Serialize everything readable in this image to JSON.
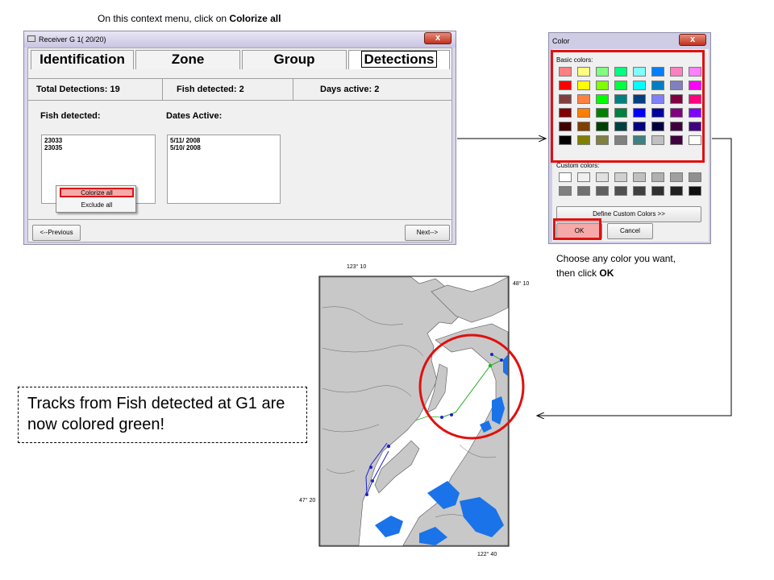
{
  "top_caption": {
    "prefix": "On this context menu, click on ",
    "bold": "Colorize all"
  },
  "receiver_window": {
    "title": "Receiver G 1( 20/20)",
    "close_label": "x",
    "tabs": [
      "Identification",
      "Zone",
      "Group",
      "Detections"
    ],
    "active_tab": "Detections",
    "stats": {
      "total_detections": "Total Detections:  19",
      "fish_detected": "Fish detected:  2",
      "days_active": "Days active:  2"
    },
    "fish_detected_label": "Fish detected:",
    "fish_list": [
      "23033",
      "23035"
    ],
    "dates_active_label": "Dates Active:",
    "dates_list": [
      "5/11/ 2008",
      "5/10/ 2008"
    ],
    "context_menu": [
      "Colorize all",
      "Exclude all"
    ],
    "previous_button": "<--Previous",
    "next_button": "Next-->"
  },
  "color_dialog": {
    "title": "Color",
    "close_label": "x",
    "basic_colors_label": "Basic colors:",
    "custom_colors_label": "Custom colors:",
    "define_custom_button": "Define Custom Colors >>",
    "ok_button": "OK",
    "cancel_button": "Cancel",
    "basic_colors": [
      "#ff8080",
      "#ffff80",
      "#80ff80",
      "#00ff80",
      "#80ffff",
      "#0080ff",
      "#ff80c0",
      "#ff80ff",
      "#ff0000",
      "#ffff00",
      "#80ff00",
      "#00ff40",
      "#00ffff",
      "#0080c0",
      "#8080c0",
      "#ff00ff",
      "#804040",
      "#ff8040",
      "#00ff00",
      "#008080",
      "#004080",
      "#8080ff",
      "#800040",
      "#ff0080",
      "#800000",
      "#ff8000",
      "#008000",
      "#008040",
      "#0000ff",
      "#0000a0",
      "#800080",
      "#8000ff",
      "#400000",
      "#804000",
      "#004000",
      "#004040",
      "#000080",
      "#000040",
      "#400040",
      "#400080",
      "#000000",
      "#808000",
      "#808040",
      "#808080",
      "#408080",
      "#c0c0c0",
      "#400040",
      "#ffffff"
    ],
    "custom_colors": [
      "#ffffff",
      "#f0f0f0",
      "#e0e0e0",
      "#d0d0d0",
      "#c0c0c0",
      "#b0b0b0",
      "#a0a0a0",
      "#909090",
      "#808080",
      "#707070",
      "#606060",
      "#505050",
      "#404040",
      "#303030",
      "#202020",
      "#101010"
    ]
  },
  "right_caption": {
    "prefix": "Choose any color you want, then click ",
    "bold": "OK"
  },
  "map": {
    "lon_left": "123° 10",
    "lon_right": "122° 40",
    "lat_top": "48° 10",
    "lat_bottom": "47° 20",
    "land_color": "#c8c8c8",
    "lake_color": "#1a73e8",
    "track_green": "#20b020",
    "track_blue": "#2020d0"
  },
  "note": "Tracks from Fish detected at G1 are now colored green!"
}
